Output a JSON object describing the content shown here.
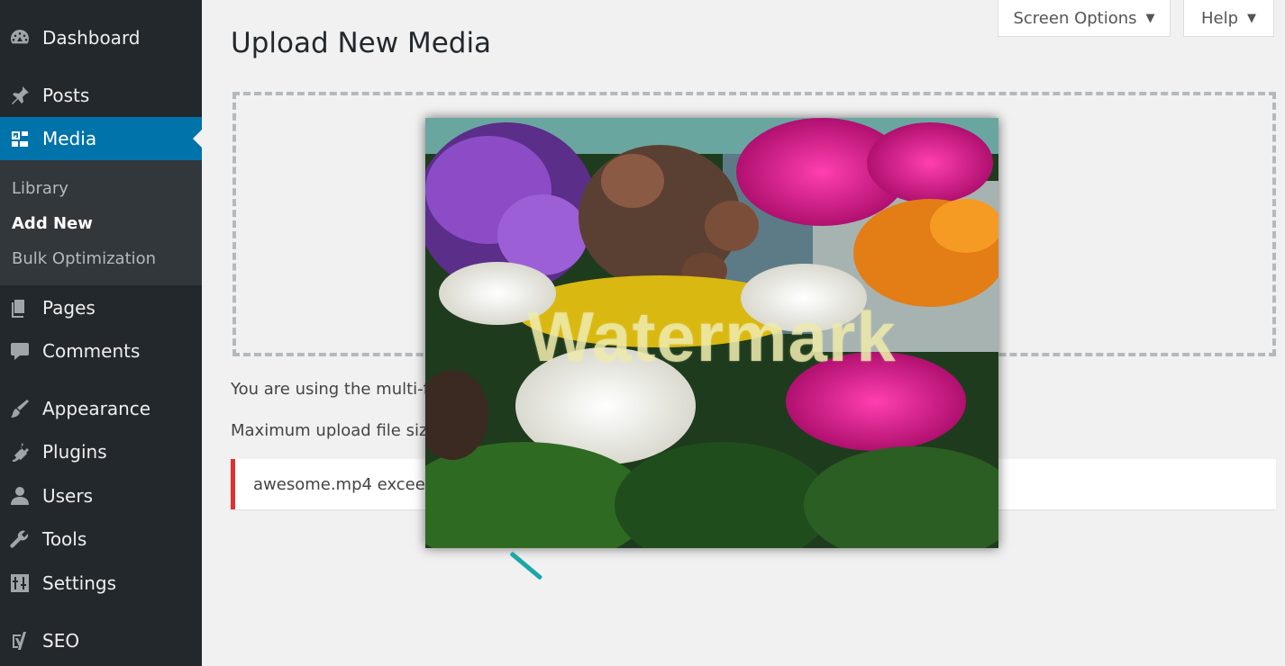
{
  "sidebar": {
    "items": [
      {
        "label": "Dashboard",
        "icon": "dashboard-icon"
      },
      {
        "label": "Posts",
        "icon": "pin-icon"
      },
      {
        "label": "Media",
        "icon": "media-icon"
      },
      {
        "label": "Pages",
        "icon": "pages-icon"
      },
      {
        "label": "Comments",
        "icon": "comment-icon"
      },
      {
        "label": "Appearance",
        "icon": "brush-icon"
      },
      {
        "label": "Plugins",
        "icon": "plugin-icon"
      },
      {
        "label": "Users",
        "icon": "user-icon"
      },
      {
        "label": "Tools",
        "icon": "wrench-icon"
      },
      {
        "label": "Settings",
        "icon": "settings-icon"
      },
      {
        "label": "SEO",
        "icon": "yoast-icon"
      }
    ],
    "submenu": [
      {
        "label": "Library"
      },
      {
        "label": "Add New"
      },
      {
        "label": "Bulk Optimization"
      }
    ]
  },
  "header": {
    "screen_options": "Screen Options",
    "help": "Help"
  },
  "main": {
    "title": "Upload New Media",
    "uploader_text": "You are using the multi-file",
    "max_size_text": "Maximum upload file size:",
    "error_notice": "awesome.mp4 exceeds"
  },
  "overlay": {
    "watermark_text": "Watermark"
  },
  "colors": {
    "sidebar_bg": "#23282d",
    "submenu_bg": "#32373c",
    "active_bg": "#0073aa",
    "error": "#dc3232",
    "page_bg": "#f1f1f1"
  }
}
